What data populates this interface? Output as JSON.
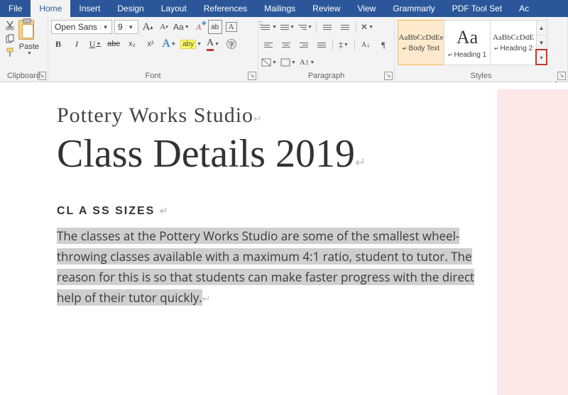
{
  "tabs": [
    "File",
    "Home",
    "Insert",
    "Design",
    "Layout",
    "References",
    "Mailings",
    "Review",
    "View",
    "Grammarly",
    "PDF Tool Set",
    "Ac"
  ],
  "active_tab": 1,
  "clipboard": {
    "paste": "Paste",
    "label": "Clipboard"
  },
  "font": {
    "name": "Open Sans",
    "size": "9",
    "label": "Font",
    "grow": "A",
    "shrink": "A",
    "case": "Aa",
    "clear_btn": "A",
    "bold": "B",
    "italic": "I",
    "underline": "U",
    "strike": "abc",
    "sub": "x₂",
    "sup": "x²",
    "effects": "A",
    "highlight": "ab",
    "color": "A"
  },
  "paragraph": {
    "label": "Paragraph"
  },
  "styles": {
    "label": "Styles",
    "items": [
      {
        "preview": "AaBbCcDdEe",
        "name": "Body Text",
        "size": "11px",
        "active": true
      },
      {
        "preview": "Aa",
        "name": "Heading 1",
        "size": "26px",
        "active": false
      },
      {
        "preview": "AaBbCcDdE",
        "name": "Heading 2",
        "size": "11px",
        "active": false
      }
    ]
  },
  "document": {
    "subtitle": "Pottery Works Studio",
    "title": "Class Details 2019",
    "heading": "CL A SS SIZES",
    "body": "The classes at the Pottery Works Studio are some of the smallest wheel- throwing classes available with a maximum 4:1 ratio, student to tutor. The reason for this is so that students can make faster progress with the direct help of their tutor quickly."
  }
}
